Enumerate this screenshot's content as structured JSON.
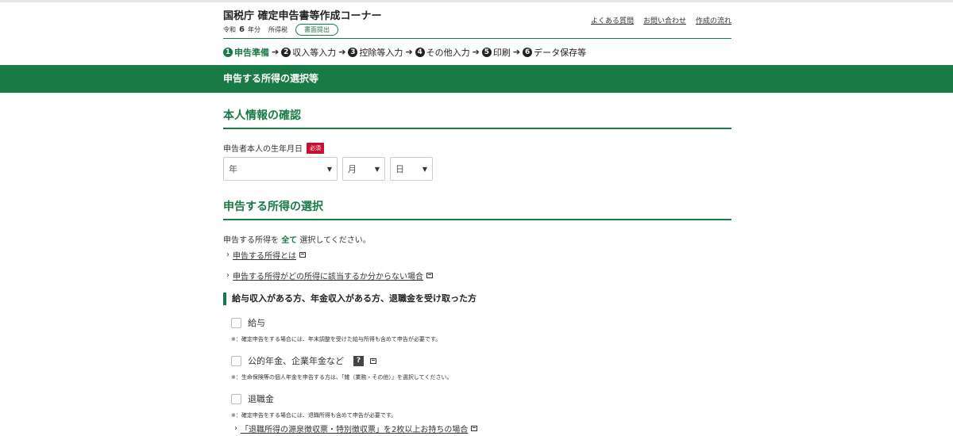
{
  "header": {
    "title": "国税庁 確定申告書等作成コーナー",
    "era": "令和",
    "year": "6",
    "year_suffix": "年分",
    "tax_type": "所得税",
    "mode_badge": "書面提出",
    "links": [
      "よくある質問",
      "お問い合わせ",
      "作成の流れ"
    ]
  },
  "steps": [
    {
      "num": "1",
      "label": "申告準備",
      "active": true
    },
    {
      "num": "2",
      "label": "収入等入力",
      "active": false
    },
    {
      "num": "3",
      "label": "控除等入力",
      "active": false
    },
    {
      "num": "4",
      "label": "その他入力",
      "active": false
    },
    {
      "num": "5",
      "label": "印刷",
      "active": false
    },
    {
      "num": "6",
      "label": "データ保存等",
      "active": false
    }
  ],
  "banner": {
    "title": "申告する所得の選択等"
  },
  "identity": {
    "heading": "本人情報の確認",
    "dob_label": "申告者本人の生年月日",
    "required": "必須",
    "year_select": "年",
    "month_select": "月",
    "day_select": "日"
  },
  "income": {
    "heading": "申告する所得の選択",
    "intro_pre": "申告する所得を",
    "intro_em": "全て",
    "intro_post": "選択してください。",
    "link1": "申告する所得とは",
    "link2": "申告する所得がどの所得に該当するか分からない場合",
    "category": "給与収入がある方、年金収入がある方、退職金を受け取った方",
    "options": [
      {
        "label": "給与",
        "note": "※：確定申告をする場合には、年末調整を受けた給与所得も含めて申告が必要です。"
      },
      {
        "label": "公的年金、企業年金など",
        "note": "※：生命保険等の個人年金を申告する方は、「雑（業務・その他）」を選択してください。",
        "help": "?"
      },
      {
        "label": "退職金",
        "note": "※：確定申告をする場合には、退職所得も含めて申告が必要です。"
      }
    ],
    "link3": "「退職所得の源泉徴収票・特別徴収票」を2枚以上お持ちの場合"
  },
  "colors": {
    "brand": "#1a7a46",
    "required": "#c8102e"
  }
}
